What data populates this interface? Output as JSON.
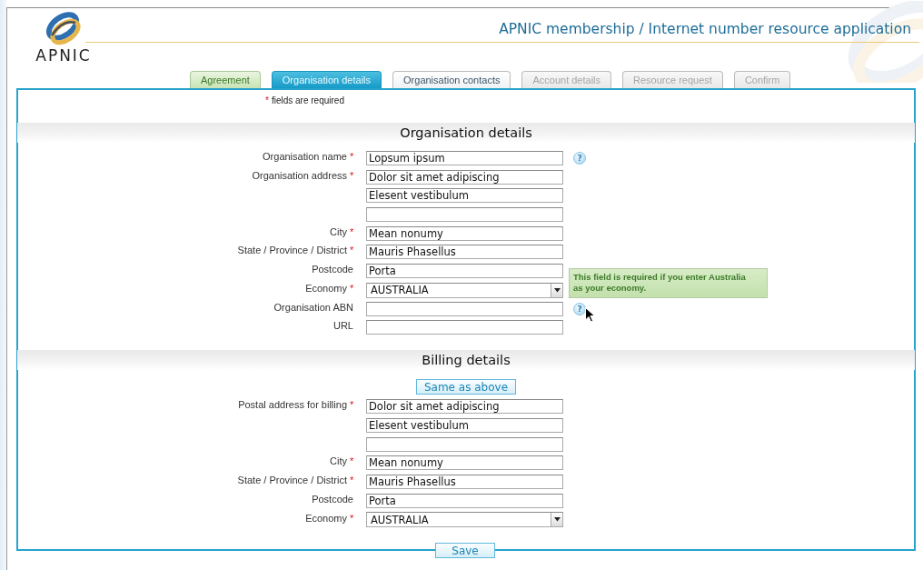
{
  "header": {
    "logo_text": "APNIC",
    "title": "APNIC membership / Internet number resource application"
  },
  "tabs": [
    {
      "label": "Agreement",
      "kind": "completed",
      "selected": false
    },
    {
      "label": "Organisation details",
      "kind": "current",
      "selected": true
    },
    {
      "label": "Organisation contacts",
      "kind": "available",
      "selected": false
    },
    {
      "label": "Account details",
      "kind": "locked",
      "selected": false
    },
    {
      "label": "Resource request",
      "kind": "locked",
      "selected": false
    },
    {
      "label": "Confirm",
      "kind": "locked",
      "selected": false
    }
  ],
  "required_note": {
    "mark": "*",
    "text": "fields are required"
  },
  "sections": [
    {
      "title": "Organisation details",
      "rows": [
        {
          "label": "Organisation name",
          "mark": "*",
          "kind": "text",
          "value": "Lopsum ipsum",
          "help": "?"
        },
        {
          "label": "Organisation address",
          "mark": "*",
          "kind": "text",
          "value": "Dolor sit amet adipiscing"
        },
        {
          "kind": "text",
          "value": "Elesent vestibulum"
        },
        {
          "kind": "text"
        },
        {
          "label": "City",
          "mark": "*",
          "kind": "text",
          "value": "Mean nonumy"
        },
        {
          "label": "State / Province / District",
          "mark": "*",
          "kind": "text",
          "value": "Mauris Phasellus"
        },
        {
          "label": "Postcode",
          "kind": "text",
          "value": "Porta"
        },
        {
          "label": "Economy",
          "mark": "*",
          "kind": "select",
          "value": "AUSTRALIA",
          "tooltip": "This field is required if you enter Australia as your economy."
        },
        {
          "label": "Organisation ABN",
          "kind": "text",
          "help": "?",
          "hovered": true
        },
        {
          "label": "URL",
          "kind": "text"
        }
      ]
    },
    {
      "title": "Billing details",
      "action": "Same as above",
      "rows": [
        {
          "label": "Postal address for billing",
          "mark": "*",
          "kind": "text",
          "value": "Dolor sit amet adipiscing"
        },
        {
          "kind": "text",
          "value": "Elesent vestibulum"
        },
        {
          "kind": "text"
        },
        {
          "label": "City",
          "mark": "*",
          "kind": "text",
          "value": "Mean nonumy"
        },
        {
          "label": "State / Province / District",
          "mark": "*",
          "kind": "text",
          "value": "Mauris Phasellus"
        },
        {
          "label": "Postcode",
          "kind": "text",
          "value": "Porta"
        },
        {
          "label": "Economy",
          "mark": "*",
          "kind": "select",
          "value": "AUSTRALIA"
        }
      ]
    }
  ],
  "save_button": "Save"
}
